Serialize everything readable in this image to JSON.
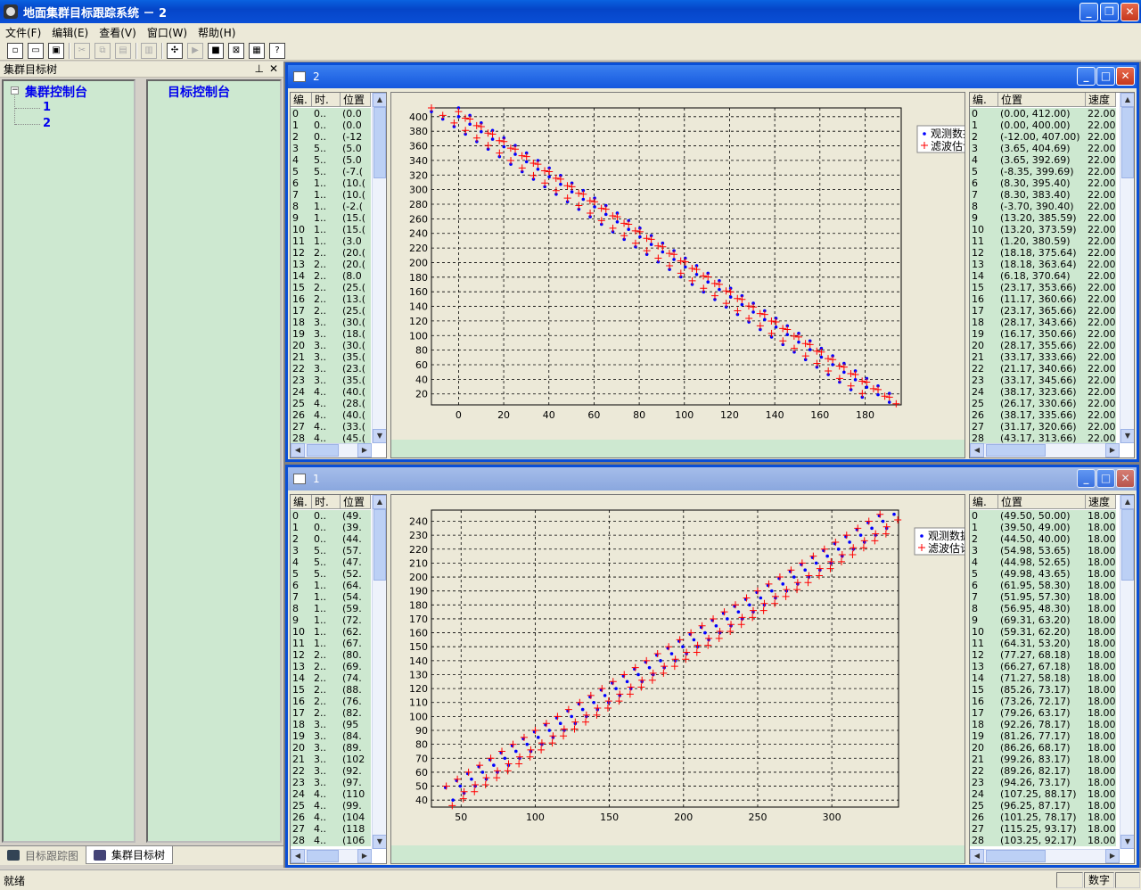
{
  "app": {
    "title": "地面集群目标跟踪系统 － 2",
    "menu": [
      "文件(F)",
      "编辑(E)",
      "查看(V)",
      "窗口(W)",
      "帮助(H)"
    ]
  },
  "left_panel": {
    "title": "集群目标树",
    "pin": "ⅹ",
    "tree_root": "集群控制台",
    "tree_children": [
      "1",
      "2"
    ],
    "tree_expander": "−",
    "right_title": "目标控制台",
    "tabs": [
      "目标跟踪图",
      "集群目标树"
    ]
  },
  "status": {
    "text": "就绪",
    "mode": "数字"
  },
  "windows": [
    {
      "title": "2",
      "table": {
        "headers": [
          "编.",
          "时.",
          "位置"
        ],
        "rows": [
          [
            "0",
            "0..",
            "(0.0"
          ],
          [
            "1",
            "0..",
            "(0.0"
          ],
          [
            "2",
            "0..",
            "(-12"
          ],
          [
            "3",
            "5..",
            "(5.0"
          ],
          [
            "4",
            "5..",
            "(5.0"
          ],
          [
            "5",
            "5..",
            "(-7.("
          ],
          [
            "6",
            "1..",
            "(10.("
          ],
          [
            "7",
            "1..",
            "(10.("
          ],
          [
            "8",
            "1..",
            "(-2.("
          ],
          [
            "9",
            "1..",
            "(15.("
          ],
          [
            "10",
            "1..",
            "(15.("
          ],
          [
            "11",
            "1..",
            "(3.0"
          ],
          [
            "12",
            "2..",
            "(20.("
          ],
          [
            "13",
            "2..",
            "(20.("
          ],
          [
            "14",
            "2..",
            "(8.0"
          ],
          [
            "15",
            "2..",
            "(25.("
          ],
          [
            "16",
            "2..",
            "(13.("
          ],
          [
            "17",
            "2..",
            "(25.("
          ],
          [
            "18",
            "3..",
            "(30.("
          ],
          [
            "19",
            "3..",
            "(18.("
          ],
          [
            "20",
            "3..",
            "(30.("
          ],
          [
            "21",
            "3..",
            "(35.("
          ],
          [
            "22",
            "3..",
            "(23.("
          ],
          [
            "23",
            "3..",
            "(35.("
          ],
          [
            "24",
            "4..",
            "(40.("
          ],
          [
            "25",
            "4..",
            "(28.("
          ],
          [
            "26",
            "4..",
            "(40.("
          ],
          [
            "27",
            "4..",
            "(33.("
          ],
          [
            "28",
            "4..",
            "(45.("
          ]
        ]
      },
      "right_table": {
        "headers": [
          "编.",
          "位置",
          "速度"
        ],
        "rows": [
          [
            "0",
            "(0.00, 412.00)",
            "22.00"
          ],
          [
            "1",
            "(0.00, 400.00)",
            "22.00"
          ],
          [
            "2",
            "(-12.00, 407.00)",
            "22.00"
          ],
          [
            "3",
            "(3.65, 404.69)",
            "22.00"
          ],
          [
            "4",
            "(3.65, 392.69)",
            "22.00"
          ],
          [
            "5",
            "(-8.35, 399.69)",
            "22.00"
          ],
          [
            "6",
            "(8.30, 395.40)",
            "22.00"
          ],
          [
            "7",
            "(8.30, 383.40)",
            "22.00"
          ],
          [
            "8",
            "(-3.70, 390.40)",
            "22.00"
          ],
          [
            "9",
            "(13.20, 385.59)",
            "22.00"
          ],
          [
            "10",
            "(13.20, 373.59)",
            "22.00"
          ],
          [
            "11",
            "(1.20, 380.59)",
            "22.00"
          ],
          [
            "12",
            "(18.18, 375.64)",
            "22.00"
          ],
          [
            "13",
            "(18.18, 363.64)",
            "22.00"
          ],
          [
            "14",
            "(6.18, 370.64)",
            "22.00"
          ],
          [
            "15",
            "(23.17, 353.66)",
            "22.00"
          ],
          [
            "16",
            "(11.17, 360.66)",
            "22.00"
          ],
          [
            "17",
            "(23.17, 365.66)",
            "22.00"
          ],
          [
            "18",
            "(28.17, 343.66)",
            "22.00"
          ],
          [
            "19",
            "(16.17, 350.66)",
            "22.00"
          ],
          [
            "20",
            "(28.17, 355.66)",
            "22.00"
          ],
          [
            "21",
            "(33.17, 333.66)",
            "22.00"
          ],
          [
            "22",
            "(21.17, 340.66)",
            "22.00"
          ],
          [
            "23",
            "(33.17, 345.66)",
            "22.00"
          ],
          [
            "24",
            "(38.17, 323.66)",
            "22.00"
          ],
          [
            "25",
            "(26.17, 330.66)",
            "22.00"
          ],
          [
            "26",
            "(38.17, 335.66)",
            "22.00"
          ],
          [
            "27",
            "(31.17, 320.66)",
            "22.00"
          ],
          [
            "28",
            "(43.17, 313.66)",
            "22.00"
          ]
        ]
      }
    },
    {
      "title": "1",
      "table": {
        "headers": [
          "编.",
          "时.",
          "位置"
        ],
        "rows": [
          [
            "0",
            "0..",
            "(49."
          ],
          [
            "1",
            "0..",
            "(39."
          ],
          [
            "2",
            "0..",
            "(44."
          ],
          [
            "3",
            "5..",
            "(57."
          ],
          [
            "4",
            "5..",
            "(47."
          ],
          [
            "5",
            "5..",
            "(52."
          ],
          [
            "6",
            "1..",
            "(64."
          ],
          [
            "7",
            "1..",
            "(54."
          ],
          [
            "8",
            "1..",
            "(59."
          ],
          [
            "9",
            "1..",
            "(72."
          ],
          [
            "10",
            "1..",
            "(62."
          ],
          [
            "11",
            "1..",
            "(67."
          ],
          [
            "12",
            "2..",
            "(80."
          ],
          [
            "13",
            "2..",
            "(69."
          ],
          [
            "14",
            "2..",
            "(74."
          ],
          [
            "15",
            "2..",
            "(88."
          ],
          [
            "16",
            "2..",
            "(76."
          ],
          [
            "17",
            "2..",
            "(82."
          ],
          [
            "18",
            "3..",
            "(95"
          ],
          [
            "19",
            "3..",
            "(84."
          ],
          [
            "20",
            "3..",
            "(89."
          ],
          [
            "21",
            "3..",
            "(102"
          ],
          [
            "22",
            "3..",
            "(92."
          ],
          [
            "23",
            "3..",
            "(97."
          ],
          [
            "24",
            "4..",
            "(110"
          ],
          [
            "25",
            "4..",
            "(99."
          ],
          [
            "26",
            "4..",
            "(104"
          ],
          [
            "27",
            "4..",
            "(118"
          ],
          [
            "28",
            "4..",
            "(106"
          ]
        ]
      },
      "right_table": {
        "headers": [
          "编.",
          "位置",
          "速度"
        ],
        "rows": [
          [
            "0",
            "(49.50, 50.00)",
            "18.00"
          ],
          [
            "1",
            "(39.50, 49.00)",
            "18.00"
          ],
          [
            "2",
            "(44.50, 40.00)",
            "18.00"
          ],
          [
            "3",
            "(54.98, 53.65)",
            "18.00"
          ],
          [
            "4",
            "(44.98, 52.65)",
            "18.00"
          ],
          [
            "5",
            "(49.98, 43.65)",
            "18.00"
          ],
          [
            "6",
            "(61.95, 58.30)",
            "18.00"
          ],
          [
            "7",
            "(51.95, 57.30)",
            "18.00"
          ],
          [
            "8",
            "(56.95, 48.30)",
            "18.00"
          ],
          [
            "9",
            "(69.31, 63.20)",
            "18.00"
          ],
          [
            "10",
            "(59.31, 62.20)",
            "18.00"
          ],
          [
            "11",
            "(64.31, 53.20)",
            "18.00"
          ],
          [
            "12",
            "(77.27, 68.18)",
            "18.00"
          ],
          [
            "13",
            "(66.27, 67.18)",
            "18.00"
          ],
          [
            "14",
            "(71.27, 58.18)",
            "18.00"
          ],
          [
            "15",
            "(85.26, 73.17)",
            "18.00"
          ],
          [
            "16",
            "(73.26, 72.17)",
            "18.00"
          ],
          [
            "17",
            "(79.26, 63.17)",
            "18.00"
          ],
          [
            "18",
            "(92.26, 78.17)",
            "18.00"
          ],
          [
            "19",
            "(81.26, 77.17)",
            "18.00"
          ],
          [
            "20",
            "(86.26, 68.17)",
            "18.00"
          ],
          [
            "21",
            "(99.26, 83.17)",
            "18.00"
          ],
          [
            "22",
            "(89.26, 82.17)",
            "18.00"
          ],
          [
            "23",
            "(94.26, 73.17)",
            "18.00"
          ],
          [
            "24",
            "(107.25, 88.17)",
            "18.00"
          ],
          [
            "25",
            "(96.25, 87.17)",
            "18.00"
          ],
          [
            "26",
            "(101.25, 78.17)",
            "18.00"
          ],
          [
            "27",
            "(115.25, 93.17)",
            "18.00"
          ],
          [
            "28",
            "(103.25, 92.17)",
            "18.00"
          ]
        ]
      }
    }
  ],
  "chart_data": [
    {
      "type": "scatter",
      "title": "",
      "xlabel": "",
      "ylabel": "",
      "xlim": [
        -12,
        196
      ],
      "ylim": [
        5,
        412
      ],
      "xticks": [
        0,
        20,
        40,
        60,
        80,
        100,
        120,
        140,
        160,
        180
      ],
      "yticks": [
        20,
        40,
        60,
        80,
        100,
        120,
        140,
        160,
        180,
        200,
        220,
        240,
        260,
        280,
        300,
        320,
        340,
        360,
        380,
        400
      ],
      "grid": true,
      "legend_position": "top-right",
      "series": [
        {
          "name": "观测数据",
          "marker": "dot",
          "color": "#0000ff",
          "start": [
            [
              0,
              400
            ],
            [
              -12,
              407
            ],
            [
              0,
              412
            ]
          ],
          "step": [
            5.02,
            -10.3
          ],
          "count": 39
        },
        {
          "name": "滤波估计",
          "marker": "plus",
          "color": "#ff0000",
          "start": [
            [
              -12,
              412
            ],
            [
              0,
              407
            ],
            [
              3,
              398
            ]
          ],
          "step": [
            5.02,
            -10.3
          ],
          "count": 39
        }
      ]
    },
    {
      "type": "scatter",
      "title": "",
      "xlabel": "",
      "ylabel": "",
      "xlim": [
        30,
        345
      ],
      "ylim": [
        35,
        248
      ],
      "xticks": [
        50,
        100,
        150,
        200,
        250,
        300
      ],
      "yticks": [
        40,
        50,
        60,
        70,
        80,
        90,
        100,
        110,
        120,
        130,
        140,
        150,
        160,
        170,
        180,
        190,
        200,
        210,
        220,
        230,
        240
      ],
      "grid": true,
      "legend_position": "top-right",
      "series": [
        {
          "name": "观测数据",
          "marker": "dot",
          "color": "#0000ff",
          "start": [
            [
              49.5,
              50
            ],
            [
              39.5,
              49
            ],
            [
              44.5,
              40
            ]
          ],
          "step": [
            7.5,
            5.0
          ],
          "count": 40
        },
        {
          "name": "滤波估计",
          "marker": "plus",
          "color": "#ff0000",
          "start": [
            [
              40,
              50
            ],
            [
              52,
              46
            ],
            [
              44,
              36
            ]
          ],
          "step": [
            7.5,
            5.0
          ],
          "count": 40
        }
      ]
    }
  ]
}
